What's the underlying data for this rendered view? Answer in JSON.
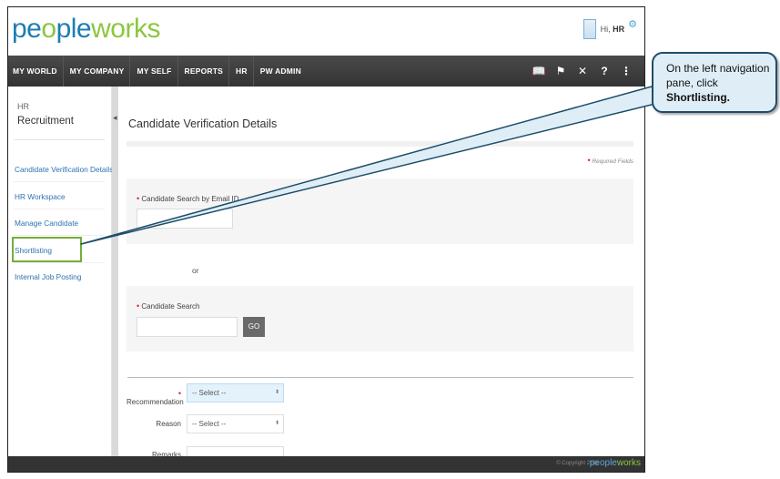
{
  "header": {
    "logo_part1": "pe",
    "logo_part2": "o",
    "logo_part3": "ple",
    "logo_part4": "w",
    "logo_part5": "o",
    "logo_part6": "rks",
    "greeting": "Hi, ",
    "user_name": "HR"
  },
  "nav": {
    "items": [
      "MY WORLD",
      "MY COMPANY",
      "MY SELF",
      "REPORTS",
      "HR",
      "PW ADMIN"
    ],
    "icons": [
      "book-icon",
      "flag-icon",
      "tools-icon",
      "help-icon",
      "share-icon"
    ]
  },
  "sidebar": {
    "module_small": "HR",
    "module_title": "Recruitment",
    "items": [
      "Candidate Verification Details",
      "HR Workspace",
      "Manage Candidate",
      "Shortlisting",
      "Internal Job Posting"
    ]
  },
  "content": {
    "page_title": "Candidate Verification Details",
    "required_note": "Required Fields",
    "email_label": "Candidate Search by Email ID",
    "or_text": "or",
    "search_label": "Candidate Search",
    "go_label": "GO",
    "recommendation_label": "Recommendation",
    "recommendation_value": "-- Select --",
    "reason_label": "Reason",
    "reason_value": "-- Select --",
    "remarks_label": "Remarks"
  },
  "footer": {
    "copyright": "© Copyright 2016",
    "logo_part1": "people",
    "logo_part2": "works"
  },
  "callout": {
    "text_line": "On the left navigation pane, click ",
    "bold_text": "Shortlisting.",
    "border_color": "#1e4d6a",
    "fill_color": "#dfeef6"
  },
  "colors": {
    "brand_blue": "#1e7db5",
    "brand_green": "#8cc63f",
    "link_blue": "#2d72b2",
    "highlight_green": "#74ad3a",
    "required_red": "#d9262c"
  }
}
